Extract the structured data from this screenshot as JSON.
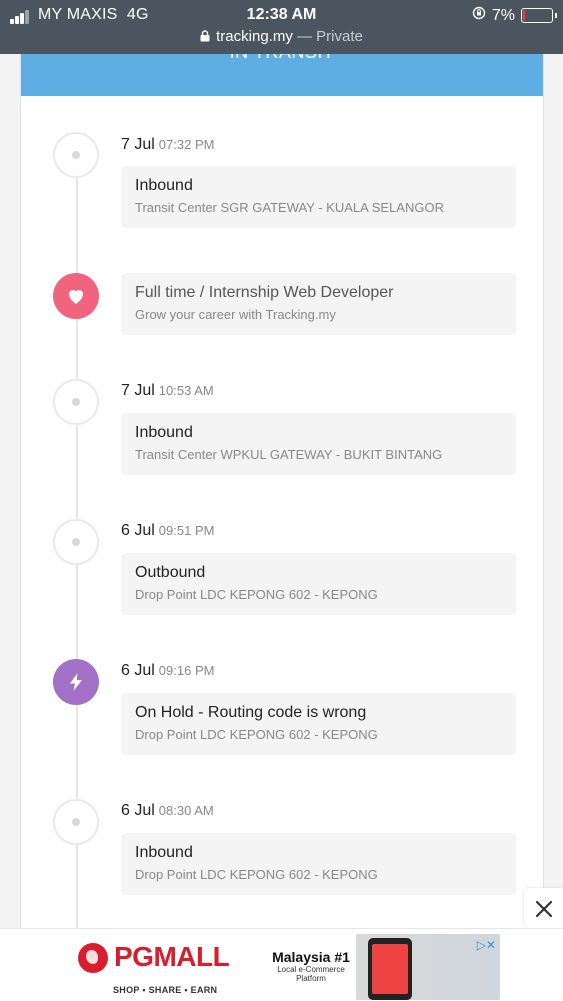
{
  "status_bar": {
    "carrier": "MY MAXIS",
    "network": "4G",
    "time": "12:38 AM",
    "battery": "7%",
    "url": "tracking.my",
    "url_suffix": "— Private"
  },
  "card": {
    "header_label": "IN TRANSIT",
    "accent_color": "#5eaee3"
  },
  "timeline": [
    {
      "date": "7 Jul",
      "time": "07:32 PM",
      "title": "Inbound",
      "detail": "Transit Center SGR GATEWAY - KUALA SELANGOR",
      "icon": "dot-icon"
    },
    {
      "title": "Full time / Internship Web Developer",
      "detail": "Grow your career with Tracking.my",
      "icon": "heart-icon"
    },
    {
      "date": "7 Jul",
      "time": "10:53 AM",
      "title": "Inbound",
      "detail": "Transit Center WPKUL GATEWAY - BUKIT BINTANG",
      "icon": "dot-icon"
    },
    {
      "date": "6 Jul",
      "time": "09:51 PM",
      "title": "Outbound",
      "detail": "Drop Point LDC KEPONG 602 - KEPONG",
      "icon": "dot-icon"
    },
    {
      "date": "6 Jul",
      "time": "09:16 PM",
      "title": "On Hold - Routing code is wrong",
      "detail": "Drop Point LDC KEPONG 602 - KEPONG",
      "icon": "lightning-icon"
    },
    {
      "date": "6 Jul",
      "time": "08:30 AM",
      "title": "Inbound",
      "detail": "Drop Point LDC KEPONG 602 - KEPONG",
      "icon": "dot-icon"
    }
  ],
  "ad": {
    "brand": "PGMALL",
    "tagline": "SHOP • SHARE • EARN",
    "headline": "Malaysia #1",
    "subline": "Local e-Commerce Platform"
  }
}
